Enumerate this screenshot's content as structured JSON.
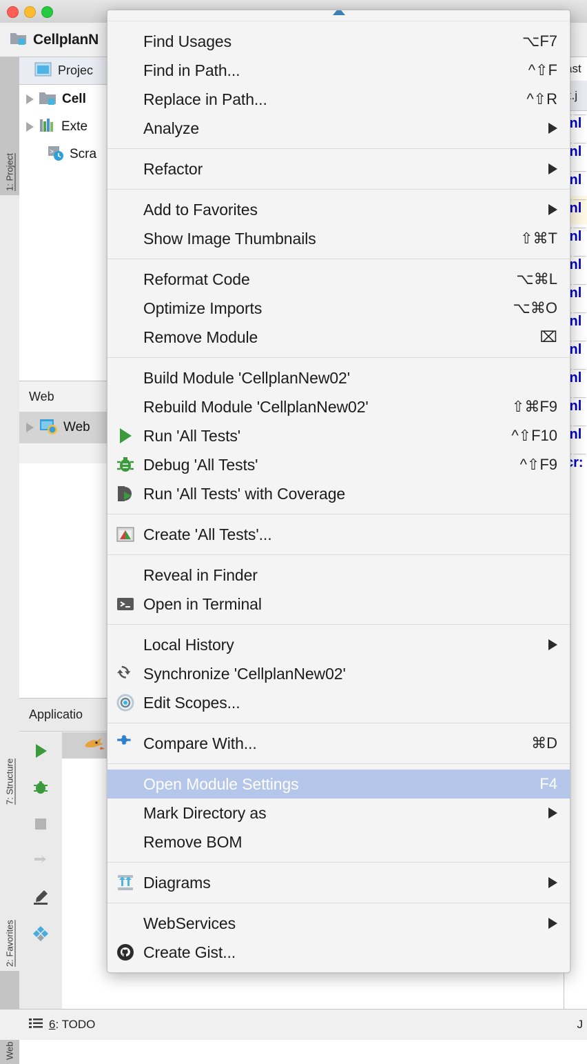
{
  "window": {
    "project_title": "CellplanN",
    "traffic_lights": [
      "close-button",
      "minimize-button",
      "zoom-button"
    ]
  },
  "sidebar_tabs": [
    {
      "label": "1: Project",
      "active": true
    },
    {
      "label": "7: Structure",
      "active": false
    },
    {
      "label": "2: Favorites",
      "active": false
    },
    {
      "label": "Web",
      "active": true
    }
  ],
  "project_panel": {
    "header": "Projec",
    "tree": [
      {
        "label": "Cell",
        "bold": true,
        "arrow": true,
        "icon": "module-folder-icon",
        "indent": 1
      },
      {
        "label": "Exte",
        "bold": false,
        "arrow": true,
        "icon": "libraries-icon",
        "indent": 1
      },
      {
        "label": "Scra",
        "bold": false,
        "arrow": false,
        "icon": "scratches-icon",
        "indent": 2
      }
    ]
  },
  "web_section": {
    "header": "Web",
    "row_label": "Web"
  },
  "run_window": {
    "header": "Applicatio",
    "tools": [
      "run-icon",
      "debug-icon",
      "stop-icon",
      "rerun-icon",
      "edit-icon",
      "settings-icon"
    ]
  },
  "editor": {
    "tab_label": "x.j",
    "top_label": "ast",
    "lines": [
      {
        "text": ".nl",
        "hl": false
      },
      {
        "text": ".nl",
        "hl": false
      },
      {
        "text": ".nl",
        "hl": false
      },
      {
        "text": ".nl",
        "hl": true
      },
      {
        "text": ".nl",
        "hl": false
      },
      {
        "text": ".nl",
        "hl": false
      },
      {
        "text": ".nl",
        "hl": false
      },
      {
        "text": ".nl",
        "hl": false
      },
      {
        "text": ".nl",
        "hl": false
      },
      {
        "text": ".nl",
        "hl": false
      },
      {
        "text": ".nl",
        "hl": false
      },
      {
        "text": ".nl",
        "hl": false
      },
      {
        "text": "cr:",
        "hl": false
      }
    ]
  },
  "status_bar": {
    "todo_label": "6: TODO",
    "right_label": "J"
  },
  "context_menu": {
    "highlight_bg": "#b4c6ea",
    "highlight_fg": "#ffffff",
    "scroll_arrow_color": "#3b7fb5",
    "groups": [
      {
        "items": [
          {
            "label": "Find Usages",
            "accel": "⌥F7",
            "icon": null,
            "submenu": false
          },
          {
            "label": "Find in Path...",
            "accel": "^⇧F",
            "icon": null,
            "submenu": false
          },
          {
            "label": "Replace in Path...",
            "accel": "^⇧R",
            "icon": null,
            "submenu": false
          },
          {
            "label": "Analyze",
            "accel": "",
            "icon": null,
            "submenu": true
          }
        ]
      },
      {
        "items": [
          {
            "label": "Refactor",
            "accel": "",
            "icon": null,
            "submenu": true
          }
        ]
      },
      {
        "items": [
          {
            "label": "Add to Favorites",
            "accel": "",
            "icon": null,
            "submenu": true
          },
          {
            "label": "Show Image Thumbnails",
            "accel": "⇧⌘T",
            "icon": null,
            "submenu": false
          }
        ]
      },
      {
        "items": [
          {
            "label": "Reformat Code",
            "accel": "⌥⌘L",
            "icon": null,
            "submenu": false
          },
          {
            "label": "Optimize Imports",
            "accel": "⌥⌘O",
            "icon": null,
            "submenu": false
          },
          {
            "label": "Remove Module",
            "accel": "⌧",
            "icon": null,
            "submenu": false
          }
        ]
      },
      {
        "items": [
          {
            "label": "Build Module 'CellplanNew02'",
            "accel": "",
            "icon": null,
            "submenu": false
          },
          {
            "label": "Rebuild Module 'CellplanNew02'",
            "accel": "⇧⌘F9",
            "icon": null,
            "submenu": false
          },
          {
            "label": "Run 'All Tests'",
            "accel": "^⇧F10",
            "icon": "run-icon",
            "submenu": false
          },
          {
            "label": "Debug 'All Tests'",
            "accel": "^⇧F9",
            "icon": "debug-icon",
            "submenu": false
          },
          {
            "label": "Run 'All Tests' with Coverage",
            "accel": "",
            "icon": "coverage-icon",
            "submenu": false
          }
        ]
      },
      {
        "items": [
          {
            "label": "Create 'All Tests'...",
            "accel": "",
            "icon": "create-test-icon",
            "submenu": false
          }
        ]
      },
      {
        "items": [
          {
            "label": "Reveal in Finder",
            "accel": "",
            "icon": null,
            "submenu": false
          },
          {
            "label": "Open in Terminal",
            "accel": "",
            "icon": "terminal-icon",
            "submenu": false
          }
        ]
      },
      {
        "items": [
          {
            "label": "Local History",
            "accel": "",
            "icon": null,
            "submenu": true
          },
          {
            "label": "Synchronize 'CellplanNew02'",
            "accel": "",
            "icon": "synchronize-icon",
            "submenu": false
          },
          {
            "label": "Edit Scopes...",
            "accel": "",
            "icon": "scopes-icon",
            "submenu": false
          }
        ]
      },
      {
        "items": [
          {
            "label": "Compare With...",
            "accel": "⌘D",
            "icon": "compare-icon",
            "submenu": false
          }
        ]
      },
      {
        "items": [
          {
            "label": "Open Module Settings",
            "accel": "F4",
            "icon": null,
            "submenu": false,
            "selected": true
          },
          {
            "label": "Mark Directory as",
            "accel": "",
            "icon": null,
            "submenu": true
          },
          {
            "label": "Remove BOM",
            "accel": "",
            "icon": null,
            "submenu": false
          }
        ]
      },
      {
        "items": [
          {
            "label": "Diagrams",
            "accel": "",
            "icon": "diagrams-icon",
            "submenu": true
          }
        ]
      },
      {
        "items": [
          {
            "label": "WebServices",
            "accel": "",
            "icon": null,
            "submenu": true
          },
          {
            "label": "Create Gist...",
            "accel": "",
            "icon": "github-icon",
            "submenu": false
          }
        ]
      }
    ]
  }
}
